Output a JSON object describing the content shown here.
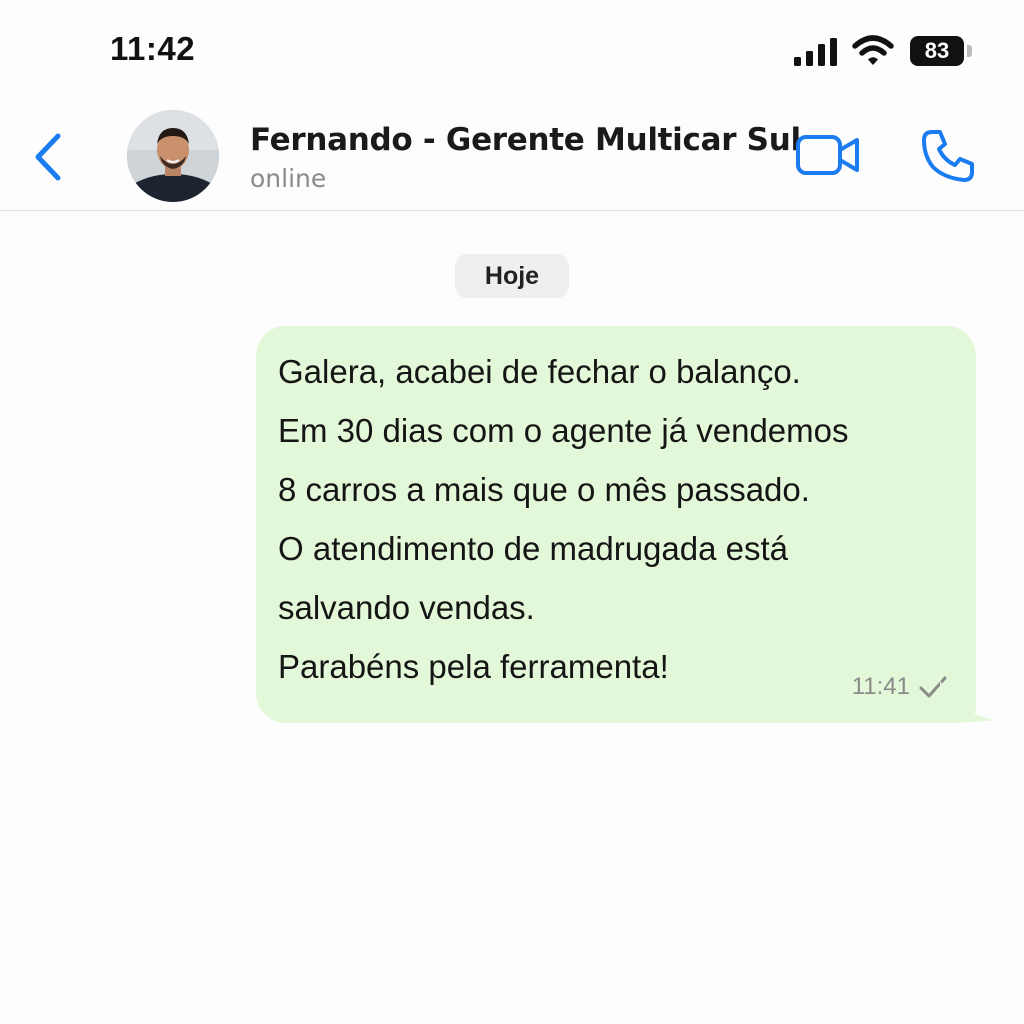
{
  "status_bar": {
    "time": "11:42",
    "battery_level": "83",
    "icons": [
      "signal-icon",
      "wifi-icon",
      "battery-icon"
    ]
  },
  "header": {
    "contact_name": "Fernando - Gerente Multicar Sul",
    "contact_status": "online",
    "icons": [
      "chevron-left-icon",
      "video-camera-icon",
      "phone-icon"
    ],
    "accent_color": "#1a7cf0"
  },
  "chat": {
    "date_label": "Hoje",
    "messages": [
      {
        "direction": "outgoing",
        "text": "Galera, acabei de fechar o balanço.\nEm 30 dias com o agente já vendemos\n8 carros a mais que o mês passado.\nO atendimento de madrugada está\nsalvando vendas.\nParabéns pela ferramenta!",
        "time": "11:41",
        "status": "sent",
        "status_icon": "check-icon",
        "bubble_color": "#e3f8d8"
      }
    ]
  }
}
